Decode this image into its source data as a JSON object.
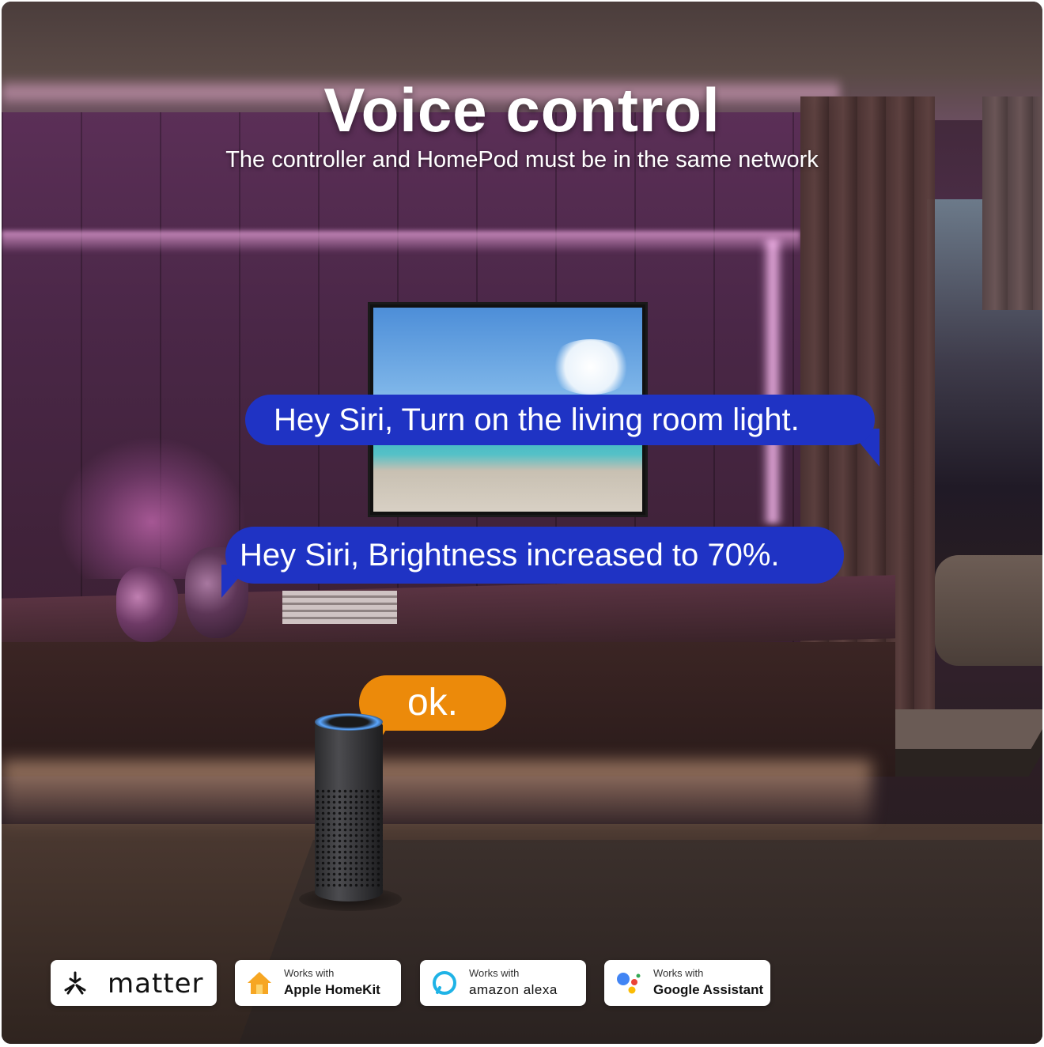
{
  "header": {
    "title": "Voice control",
    "subtitle": "The controller and HomePod must be in the same network"
  },
  "chat": {
    "command_1": "Hey Siri, Turn on the living room light.",
    "command_2": "Hey Siri, Brightness increased to 70%.",
    "reply": "ok."
  },
  "badges": [
    {
      "name": "matter",
      "text": "matter",
      "icon": "matter-icon"
    },
    {
      "name": "homekit",
      "small": "Works with",
      "big": "Apple HomeKit",
      "icon": "homekit-house-icon"
    },
    {
      "name": "alexa",
      "small": "Works with",
      "big": "amazon alexa",
      "icon": "alexa-ring-icon"
    },
    {
      "name": "google",
      "small": "Works with",
      "big": "Google Assistant",
      "icon": "google-assistant-dots-icon"
    }
  ],
  "colors": {
    "user_bubble": "#1f33c4",
    "reply_bubble": "#ec8a0a",
    "ambient_light": "#e0a0e0"
  }
}
